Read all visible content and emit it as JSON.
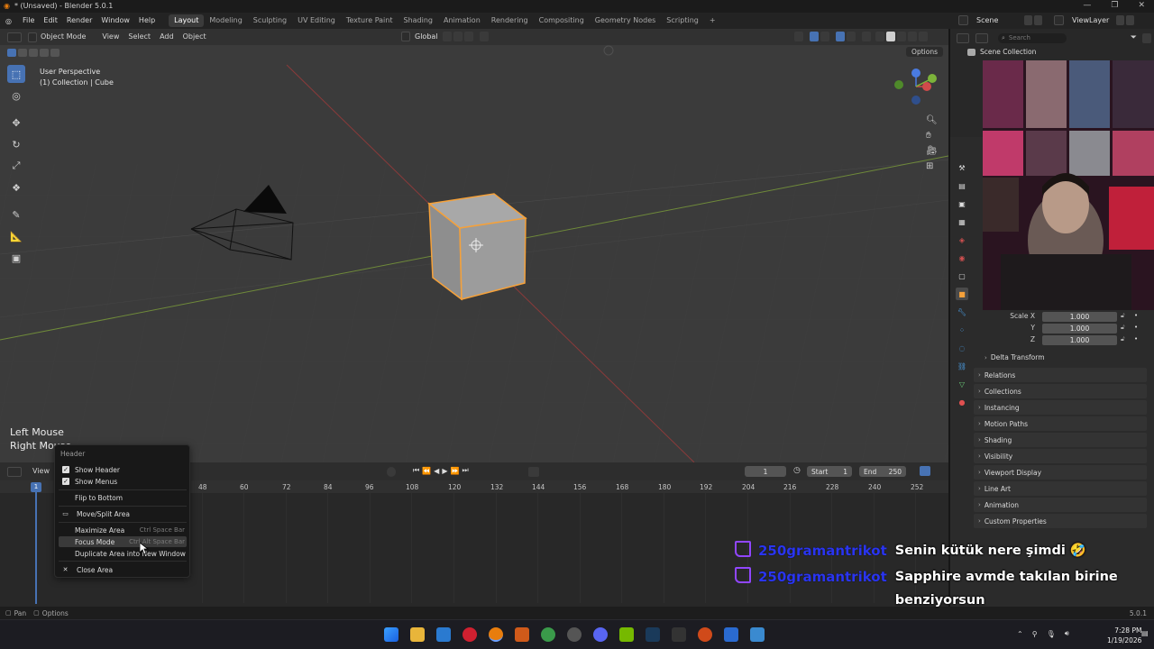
{
  "window": {
    "title": "* (Unsaved) - Blender 5.0.1",
    "buttons": [
      "—",
      "❐",
      "✕"
    ]
  },
  "menubar": {
    "menus": [
      "File",
      "Edit",
      "Render",
      "Window",
      "Help"
    ],
    "workspaces": [
      "Layout",
      "Modeling",
      "Sculpting",
      "UV Editing",
      "Texture Paint",
      "Shading",
      "Animation",
      "Rendering",
      "Compositing",
      "Geometry Nodes",
      "Scripting"
    ],
    "add_tab": "+",
    "scene_label": "Scene",
    "view_layer_label": "ViewLayer"
  },
  "viewport": {
    "mode": "Object Mode",
    "menus": [
      "View",
      "Select",
      "Add",
      "Object"
    ],
    "orientation": "Global",
    "options_label": "Options",
    "overlay_title": "User Perspective",
    "overlay_subtitle": "(1) Collection | Cube",
    "mouse_hint": [
      "Left Mouse",
      "Right Mouse"
    ]
  },
  "context_menu": {
    "header": "Header",
    "items": [
      {
        "label": "Show Header",
        "checked": true
      },
      {
        "label": "Show Menus",
        "checked": true
      },
      {
        "label": "Flip to Bottom"
      },
      {
        "label": "Move/Split Area",
        "icon": "move-split-icon"
      },
      {
        "label": "Maximize Area",
        "shortcut": "Ctrl Space Bar"
      },
      {
        "label": "Focus Mode",
        "shortcut": "Ctrl Alt Space Bar"
      },
      {
        "label": "Duplicate Area into New Window"
      },
      {
        "label": "Close Area",
        "icon": "close-icon"
      }
    ]
  },
  "timeline": {
    "view_label": "View",
    "current_frame": "1",
    "start_label": "Start",
    "start_value": "1",
    "end_label": "End",
    "end_value": "250",
    "ruler": [
      "48",
      "60",
      "72",
      "84",
      "96",
      "108",
      "120",
      "132",
      "144",
      "156",
      "168",
      "180",
      "192",
      "204",
      "216",
      "228",
      "240",
      "252"
    ],
    "playhead": "1"
  },
  "outliner": {
    "search_placeholder": "Search",
    "root": "Scene Collection"
  },
  "properties": {
    "scale": [
      {
        "label": "Scale X",
        "value": "1.000"
      },
      {
        "label": "Y",
        "value": "1.000"
      },
      {
        "label": "Z",
        "value": "1.000"
      }
    ],
    "delta_transform": "Delta Transform",
    "panels": [
      "Relations",
      "Collections",
      "Instancing",
      "Motion Paths",
      "Shading",
      "Visibility",
      "Viewport Display",
      "Line Art",
      "Animation",
      "Custom Properties"
    ]
  },
  "statusbar": {
    "pan": "Pan",
    "options": "Options",
    "version": "5.0.1"
  },
  "chat": [
    {
      "user": "250gramantrikot",
      "message": "Senin kütük nere şimdi 🤣"
    },
    {
      "user": "250gramantrikot",
      "message": "Sapphire avmde takılan birine benziyorsun"
    }
  ],
  "taskbar": {
    "time": "7:28 PM",
    "date": "1/19/2026"
  },
  "colors": {
    "accent": "#4772b3",
    "selection_outline": "#f5a13a",
    "chat_username": "#2a35f0",
    "twitch": "#9146ff"
  }
}
